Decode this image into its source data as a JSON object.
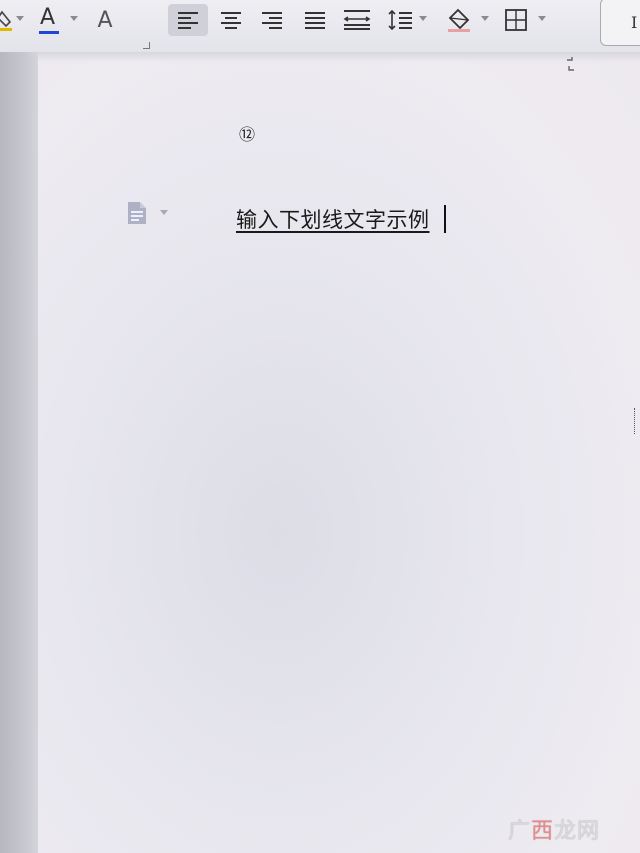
{
  "toolbar": {
    "font_color_label": "A",
    "clear_format_label": "A"
  },
  "document": {
    "list_marker": "⑫",
    "text": "输入下划线文字示例"
  },
  "right_stub_text": "I",
  "watermark": {
    "part1": "广",
    "part2": "西",
    "part3": "龙网"
  },
  "colors": {
    "font_color_underline": "#1f45d6",
    "watermark_red": "#e9898a"
  },
  "icons": [
    "paint-bucket-icon",
    "font-color-icon",
    "clear-format-icon",
    "align-left-icon",
    "align-center-icon",
    "align-right-icon",
    "justify-icon",
    "distributed-align-icon",
    "line-spacing-icon",
    "shading-icon",
    "borders-icon",
    "document-icon"
  ]
}
